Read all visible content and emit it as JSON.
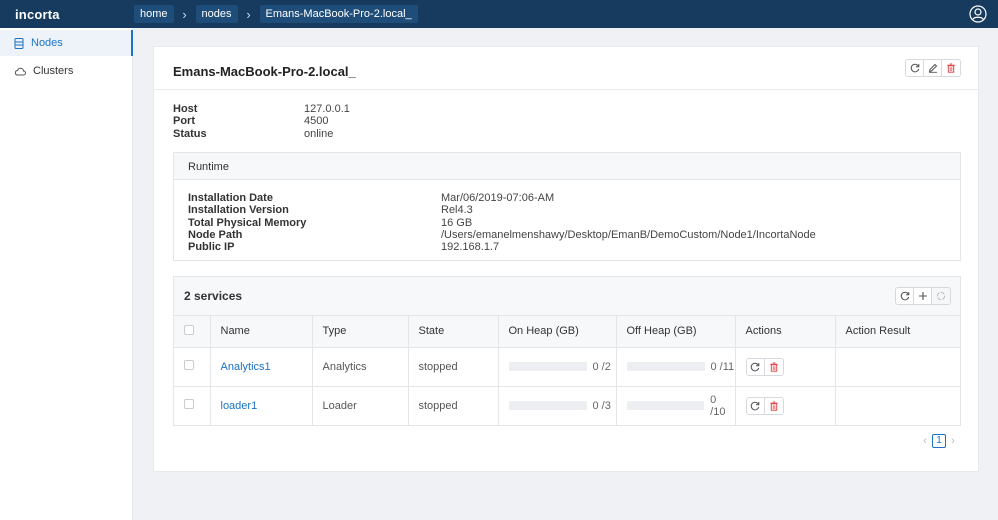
{
  "app": {
    "logo": "incorta"
  },
  "breadcrumb": {
    "items": [
      "home",
      "nodes",
      "Emans-MacBook-Pro-2.local_"
    ]
  },
  "sidebar": {
    "items": [
      {
        "label": "Nodes"
      },
      {
        "label": "Clusters"
      }
    ]
  },
  "node": {
    "title": "Emans-MacBook-Pro-2.local_",
    "info": [
      {
        "label": "Host",
        "value": "127.0.0.1"
      },
      {
        "label": "Port",
        "value": "4500"
      },
      {
        "label": "Status",
        "value": "online"
      }
    ]
  },
  "runtime": {
    "title": "Runtime",
    "info": [
      {
        "label": "Installation Date",
        "value": "Mar/06/2019-07:06-AM"
      },
      {
        "label": "Installation Version",
        "value": "Rel4.3"
      },
      {
        "label": "Total Physical Memory",
        "value": "16 GB"
      },
      {
        "label": "Node Path",
        "value": "/Users/emanelmenshawy/Desktop/EmanB/DemoCustom/Node1/IncortaNode"
      },
      {
        "label": "Public IP",
        "value": "192.168.1.7"
      }
    ]
  },
  "services": {
    "title": "2 services",
    "columns": [
      "",
      "Name",
      "Type",
      "State",
      "On Heap (GB)",
      "Off Heap (GB)",
      "Actions",
      "Action Result"
    ],
    "rows": [
      {
        "name": "Analytics1",
        "type": "Analytics",
        "state": "stopped",
        "on_heap": "0 /2",
        "on_heap_used": 0,
        "off_heap": "0 /11",
        "off_heap_used": 0,
        "action_result": ""
      },
      {
        "name": "loader1",
        "type": "Loader",
        "state": "stopped",
        "on_heap": "0 /3",
        "on_heap_used": 0,
        "off_heap": "0 /10",
        "off_heap_used": 0,
        "action_result": ""
      }
    ]
  },
  "pagination": {
    "current": "1"
  },
  "colors": {
    "topbar": "#163b5f",
    "accent": "#1a73c5",
    "danger": "#e04a4a"
  }
}
